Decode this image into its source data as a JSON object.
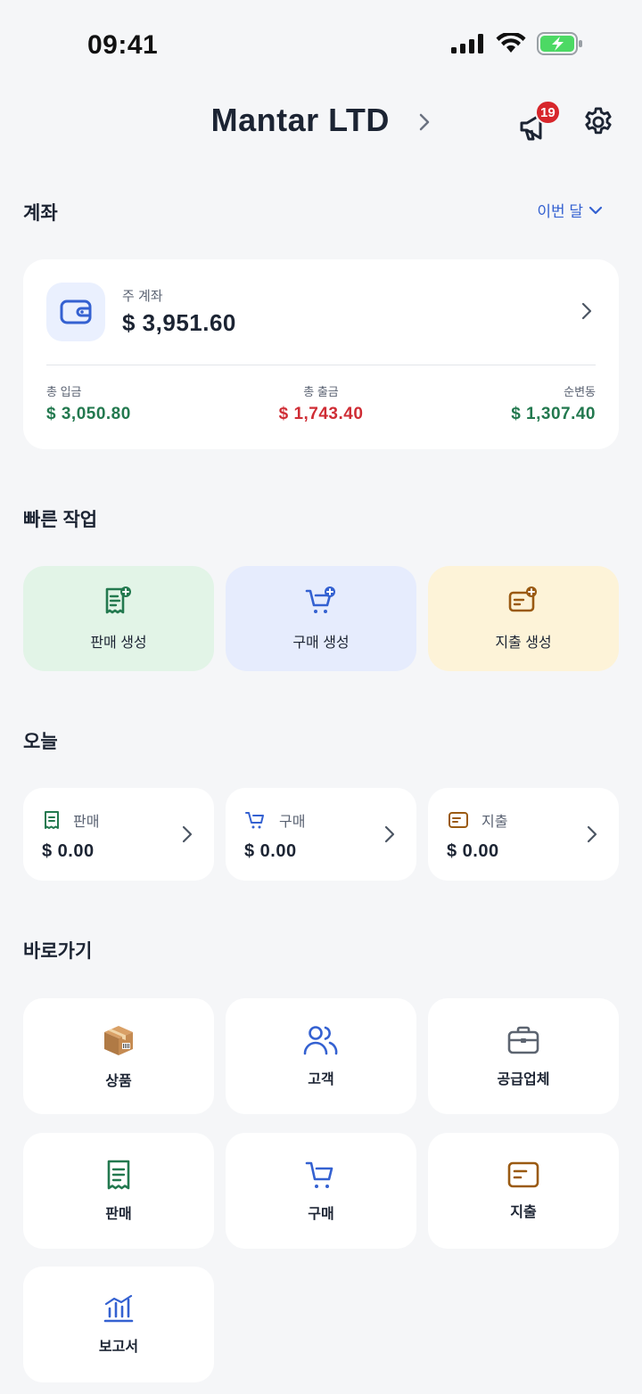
{
  "status_bar": {
    "time": "09:41"
  },
  "header": {
    "company_name": "Mantar LTD",
    "notification_count": "19"
  },
  "account_section": {
    "title": "계좌",
    "period_label": "이번 달",
    "main_account_label": "주 계좌",
    "main_account_balance": "$ 3,951.60",
    "total_income_label": "총 입금",
    "total_income_value": "$ 3,050.80",
    "total_expense_label": "총 출금",
    "total_expense_value": "$ 1,743.40",
    "net_change_label": "순변동",
    "net_change_value": "$ 1,307.40"
  },
  "quick_actions": {
    "title": "빠른 작업",
    "items": [
      {
        "label": "판매 생성",
        "icon": "receipt-plus-icon"
      },
      {
        "label": "구매 생성",
        "icon": "cart-plus-icon"
      },
      {
        "label": "지출 생성",
        "icon": "card-plus-icon"
      }
    ]
  },
  "today": {
    "title": "오늘",
    "items": [
      {
        "label": "판매",
        "value": "$ 0.00",
        "icon": "receipt-icon"
      },
      {
        "label": "구매",
        "value": "$ 0.00",
        "icon": "cart-icon"
      },
      {
        "label": "지출",
        "value": "$ 0.00",
        "icon": "card-icon"
      }
    ]
  },
  "shortcuts": {
    "title": "바로가기",
    "items": [
      {
        "label": "상품",
        "icon": "package-icon"
      },
      {
        "label": "고객",
        "icon": "users-icon"
      },
      {
        "label": "공급업체",
        "icon": "briefcase-icon"
      },
      {
        "label": "판매",
        "icon": "receipt-icon"
      },
      {
        "label": "구매",
        "icon": "cart-icon"
      },
      {
        "label": "지출",
        "icon": "card-icon"
      },
      {
        "label": "보고서",
        "icon": "chart-icon"
      }
    ]
  },
  "colors": {
    "accent_blue": "#3461d1",
    "income_green": "#23794f",
    "expense_red": "#cf2d35",
    "sales_bg": "#e2f4e7",
    "purchase_bg": "#e6ecfd",
    "expense_bg": "#fdf3d8",
    "brown": "#9a5a12"
  }
}
